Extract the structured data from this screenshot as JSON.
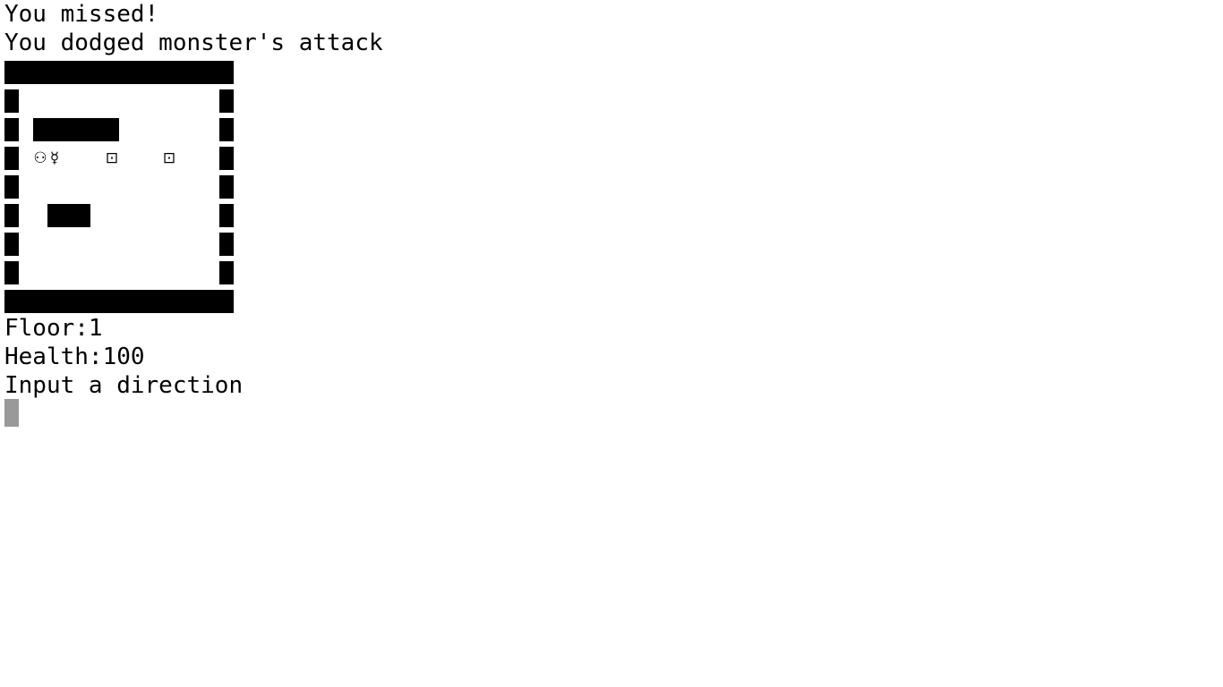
{
  "messages": {
    "line1": "You missed!",
    "line2": "You dodged monster's attack"
  },
  "map": {
    "player_symbol": "⚇",
    "monster_symbol": "☿",
    "item_symbol": "⊡"
  },
  "status": {
    "floor": "Floor:1",
    "health": "Health:100"
  },
  "prompt": {
    "text": "Input a direction"
  },
  "colors": {
    "foreground": "#000000",
    "background": "#ffffff",
    "cursor": "#999999"
  }
}
